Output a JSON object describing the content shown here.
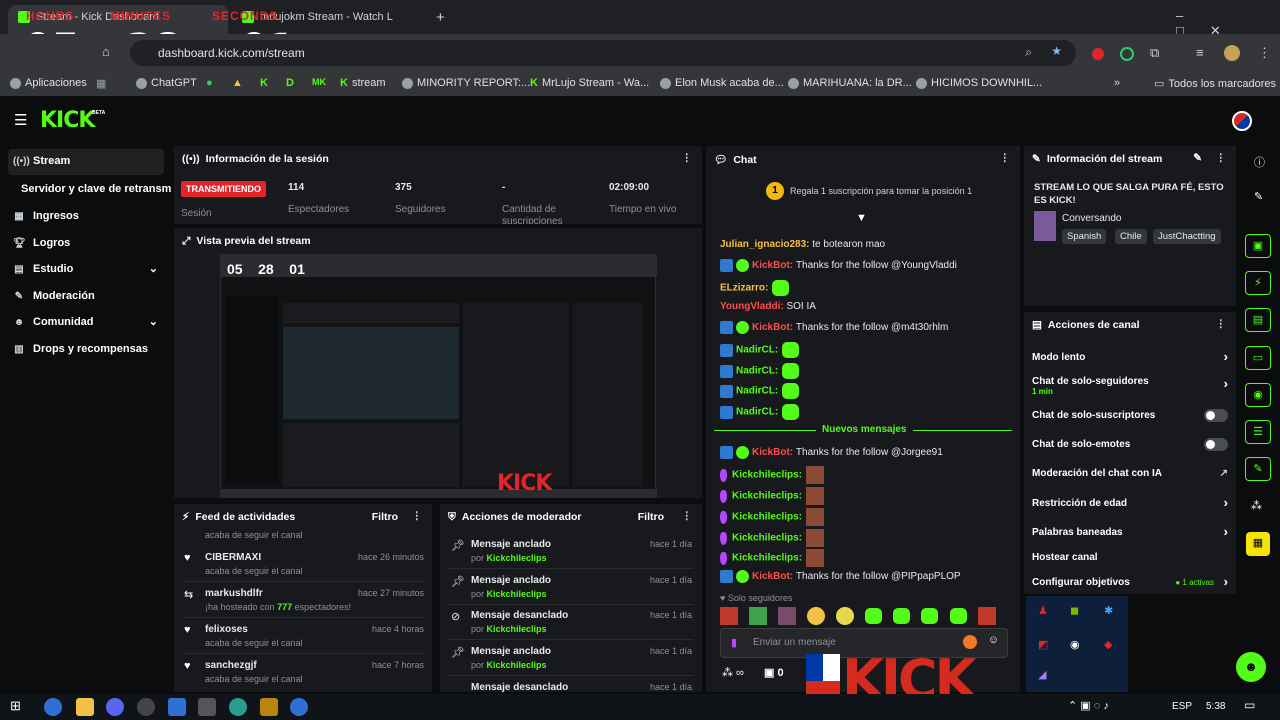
{
  "browser": {
    "tabs": [
      {
        "title": "Stream - Kick Dashboard"
      },
      {
        "title": "mrlujokm Stream - Watch L"
      }
    ],
    "url": "dashboard.kick.com/stream",
    "bookmarks": [
      "Aplicaciones",
      "ChatGPT",
      "stream",
      "MINORITY REPORT:...",
      "MrLujo Stream - Wa...",
      "Elon Musk acaba de...",
      "MARIHUANA: la DR...",
      "HICIMOS DOWNHIL..."
    ],
    "all_bookmarks": "Todos los marcadores"
  },
  "timer": {
    "hours_label": "HOURS",
    "minutes_label": "MINUTES",
    "seconds_label": "SECONDS",
    "hours": "05",
    "minutes": "28",
    "seconds": "01"
  },
  "kick": {
    "logo": "KICK",
    "beta": "BETA"
  },
  "sidebar": {
    "items": [
      {
        "label": "Stream",
        "icon": "broadcast-icon"
      },
      {
        "label": "Servidor y clave de retransmisión"
      },
      {
        "label": "Ingresos",
        "icon": "income-icon"
      },
      {
        "label": "Logros",
        "icon": "trophy-icon"
      },
      {
        "label": "Estudio",
        "icon": "studio-icon"
      },
      {
        "label": "Moderación",
        "icon": "wrench-icon"
      },
      {
        "label": "Comunidad",
        "icon": "community-icon"
      },
      {
        "label": "Drops y recompensas",
        "icon": "drops-icon"
      }
    ]
  },
  "session": {
    "title": "Información de la sesión",
    "live_badge": "TRANSMITIENDO",
    "session_label": "Sesión",
    "viewers": "114",
    "viewers_label": "Espectadores",
    "followers": "375",
    "followers_label": "Seguidores",
    "subs": "-",
    "subs_label": "Cantidad de suscripciones",
    "time": "02:09:00",
    "time_label": "Tiempo en vivo"
  },
  "preview": {
    "title": "Vista previa del stream"
  },
  "activity": {
    "title": "Feed de actividades",
    "filter": "Filtro",
    "items": [
      {
        "name": "",
        "desc": "acaba de seguir el canal",
        "time": ""
      },
      {
        "name": "CIBERMAXI",
        "desc": "acaba de seguir el canal",
        "time": "hace 26 minutos"
      },
      {
        "name": "markushdlfr",
        "desc_pre": "¡ha hosteado con",
        "count": "777",
        "desc_post": "espectadores!",
        "time": "hace 27 minutos"
      },
      {
        "name": "felixoses",
        "desc": "acaba de seguir el canal",
        "time": "hace 4 horas"
      },
      {
        "name": "sanchezgjf",
        "desc": "acaba de seguir el canal",
        "time": "hace 7 horas"
      }
    ]
  },
  "modactions": {
    "title": "Acciones de moderador",
    "filter": "Filtro",
    "items": [
      {
        "action": "Mensaje anclado",
        "by": "por",
        "user": "Kickchileclips",
        "time": "hace 1 día"
      },
      {
        "action": "Mensaje anclado",
        "by": "por",
        "user": "Kickchileclips",
        "time": "hace 1 día"
      },
      {
        "action": "Mensaje desanclado",
        "by": "por",
        "user": "Kickchileclips",
        "time": "hace 1 día"
      },
      {
        "action": "Mensaje anclado",
        "by": "por",
        "user": "Kickchileclips",
        "time": "hace 1 día"
      },
      {
        "action": "Mensaje desanclado",
        "by": "",
        "user": "",
        "time": "hace 1 día"
      }
    ]
  },
  "chat": {
    "title": "Chat",
    "gift_rank": "1",
    "gift_text": "Regala 1 suscripción para tomar la posición 1",
    "messages": [
      {
        "user": "Julian_ignacio283:",
        "text": "te botearon mao",
        "color": "#f3c244"
      },
      {
        "user": "KickBot:",
        "text": "Thanks for the follow @YoungVladdi",
        "color": "#ff4d4d",
        "badges": "bot"
      },
      {
        "user": "ELzizarro:",
        "text": "",
        "color": "#f3c244",
        "emoji": true
      },
      {
        "user": "YoungVladdi:",
        "text": "SOI IA",
        "color": "#ff4d4d"
      },
      {
        "user": "KickBot:",
        "text": "Thanks for the follow @m4t30rhlm",
        "color": "#ff4d4d",
        "badges": "bot"
      },
      {
        "user": "NadirCL:",
        "text": "",
        "color": "#53fc18",
        "emoji": true,
        "badges": "mod"
      },
      {
        "user": "NadirCL:",
        "text": "",
        "color": "#53fc18",
        "emoji": true,
        "badges": "mod"
      },
      {
        "user": "NadirCL:",
        "text": "",
        "color": "#53fc18",
        "emoji": true,
        "badges": "mod"
      },
      {
        "user": "NadirCL:",
        "text": "",
        "color": "#53fc18",
        "emoji": true,
        "badges": "mod"
      }
    ],
    "new_messages": "Nuevos mensajes",
    "messages2": [
      {
        "user": "KickBot:",
        "text": "Thanks for the follow @Jorgee91",
        "color": "#ff4d4d"
      },
      {
        "user": "Kickchileclips:",
        "color": "#53fc18"
      },
      {
        "user": "Kickchileclips:",
        "color": "#53fc18"
      },
      {
        "user": "Kickchileclips:",
        "color": "#53fc18"
      },
      {
        "user": "Kickchileclips:",
        "color": "#53fc18"
      },
      {
        "user": "Kickchileclips:",
        "color": "#53fc18"
      },
      {
        "user": "KickBot:",
        "text": "Thanks for the follow @PIPpapPLOP",
        "color": "#ff4d4d"
      }
    ],
    "followers_only": "Solo seguidores",
    "input_placeholder": "Enviar un mensaje",
    "points": "0"
  },
  "stream_info": {
    "title": "Información del stream",
    "stream_title": "STREAM LO QUE SALGA PURA FÉ, ESTO ES KICK!",
    "category": "Conversando",
    "tags": [
      "Spanish",
      "Chile",
      "JustChactting"
    ]
  },
  "channel_actions": {
    "title": "Acciones de canal",
    "items": [
      {
        "label": "Modo lento",
        "kind": "chevron"
      },
      {
        "label": "Chat de solo-seguidores",
        "sub": "1 min",
        "kind": "chevron"
      },
      {
        "label": "Chat de solo-suscriptores",
        "kind": "toggle"
      },
      {
        "label": "Chat de solo-emotes",
        "kind": "toggle"
      },
      {
        "label": "Moderación del chat con IA",
        "kind": "link"
      },
      {
        "label": "Restricción de edad",
        "kind": "chevron"
      },
      {
        "label": "Palabras baneadas",
        "kind": "chevron"
      },
      {
        "label": "Hostear canal",
        "kind": "none"
      },
      {
        "label": "Configurar objetivos",
        "kind": "chevron",
        "extra": "1 activas"
      }
    ]
  },
  "taskbar": {
    "lang": "ESP",
    "time": "5:38"
  },
  "colors": {
    "kick_green": "#53fc18",
    "live_red": "#e0262a",
    "panel": "#18191c"
  }
}
